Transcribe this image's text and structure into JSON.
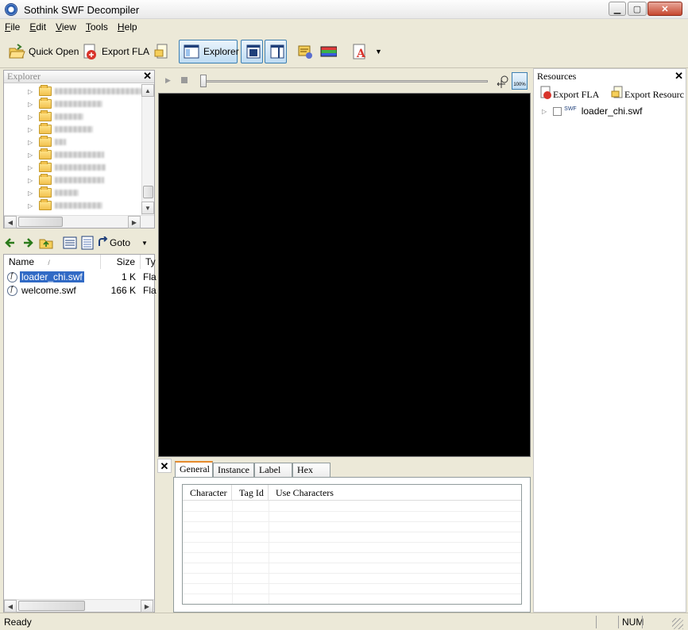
{
  "window": {
    "title": "Sothink SWF Decompiler",
    "controls": {
      "minimize": "▁",
      "maximize": "▢",
      "close": "✕"
    }
  },
  "menu": {
    "items": [
      {
        "label": "File",
        "accel": "F"
      },
      {
        "label": "Edit",
        "accel": "E"
      },
      {
        "label": "View",
        "accel": "V"
      },
      {
        "label": "Tools",
        "accel": "T"
      },
      {
        "label": "Help",
        "accel": "H"
      }
    ]
  },
  "toolbar": {
    "quick_open": "Quick Open",
    "export_fla": "Export FLA",
    "explorer": "Explorer",
    "dropdown_glyph": "▼"
  },
  "explorer_panel": {
    "title": "Explorer",
    "close_glyph": "✕",
    "tree_items_count_visible": 10
  },
  "file_nav": {
    "goto_label": "Goto",
    "columns": [
      {
        "label": "Name",
        "sort_glyph": "/"
      },
      {
        "label": "Size"
      },
      {
        "label": "Ty"
      }
    ],
    "files": [
      {
        "name": "loader_chi.swf",
        "size": "1 K",
        "type": "Fla",
        "selected": true
      },
      {
        "name": "welcome.swf",
        "size": "166 K",
        "type": "Fla",
        "selected": false
      }
    ]
  },
  "preview": {
    "zoom_label": "100%"
  },
  "properties": {
    "close_glyph": "✕",
    "tabs": [
      "General",
      "Instance",
      "Label",
      "Hex"
    ],
    "active_tab": "General",
    "table_headers": [
      "Character",
      "Tag Id",
      "Use Characters"
    ]
  },
  "resources_panel": {
    "title": "Resources",
    "close_glyph": "✕",
    "export_fla": "Export FLA",
    "export_resources": "Export Resourc",
    "tree": [
      {
        "badge": "SWF",
        "label": "loader_chi.swf"
      }
    ]
  },
  "statusbar": {
    "text": "Ready",
    "num": "NUM"
  },
  "colors": {
    "window_bg": "#ece9d8",
    "preview_stage": "#000000",
    "selection": "#316ac5",
    "active_tab_accent": "#e68b2c"
  }
}
